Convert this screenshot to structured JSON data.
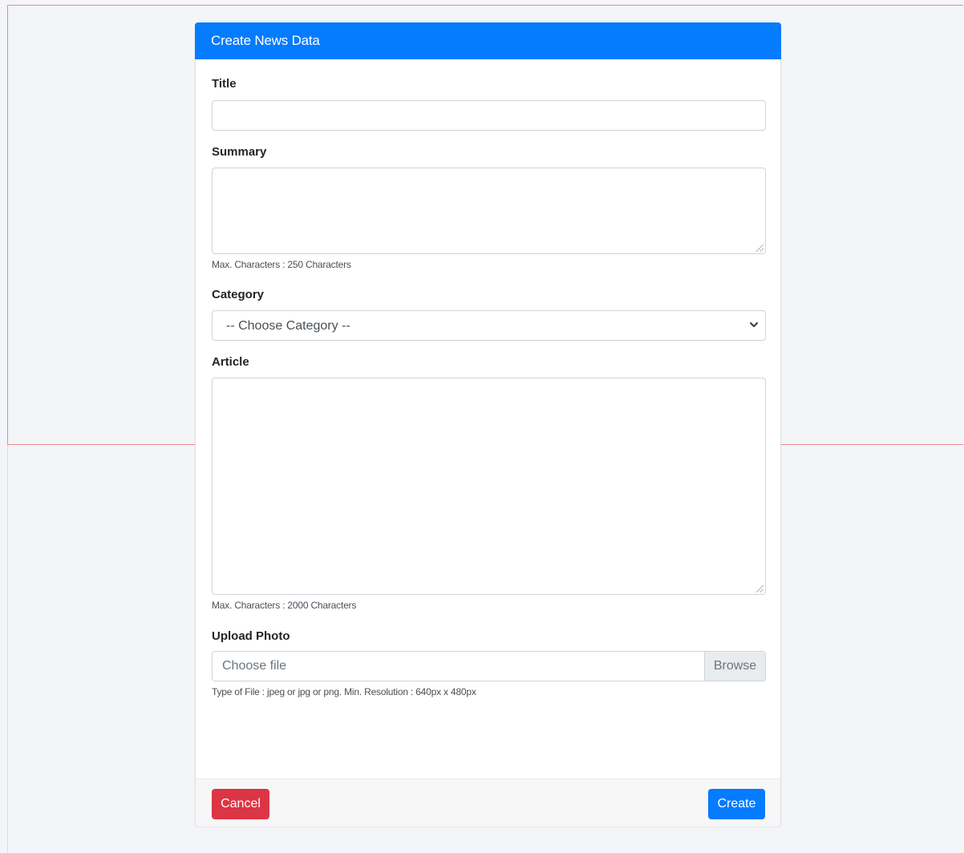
{
  "card": {
    "header_title": "Create News Data"
  },
  "form": {
    "title": {
      "label": "Title",
      "value": ""
    },
    "summary": {
      "label": "Summary",
      "value": "",
      "help": "Max. Characters : 250 Characters"
    },
    "category": {
      "label": "Category",
      "selected": "-- Choose Category --"
    },
    "article": {
      "label": "Article",
      "value": "",
      "help": "Max. Characters : 2000 Characters"
    },
    "upload_photo": {
      "label": "Upload Photo",
      "placeholder": "Choose file",
      "browse_label": "Browse",
      "help": "Type of File : jpeg or jpg or png. Min. Resolution : 640px x 480px"
    }
  },
  "footer": {
    "cancel_label": "Cancel",
    "create_label": "Create"
  },
  "colors": {
    "primary": "#057bfe",
    "danger": "#dc3545",
    "background": "#f3f5f8"
  },
  "icons": {
    "category_dropdown": "chevron-down-icon",
    "resize": "resize-grip-icon"
  }
}
